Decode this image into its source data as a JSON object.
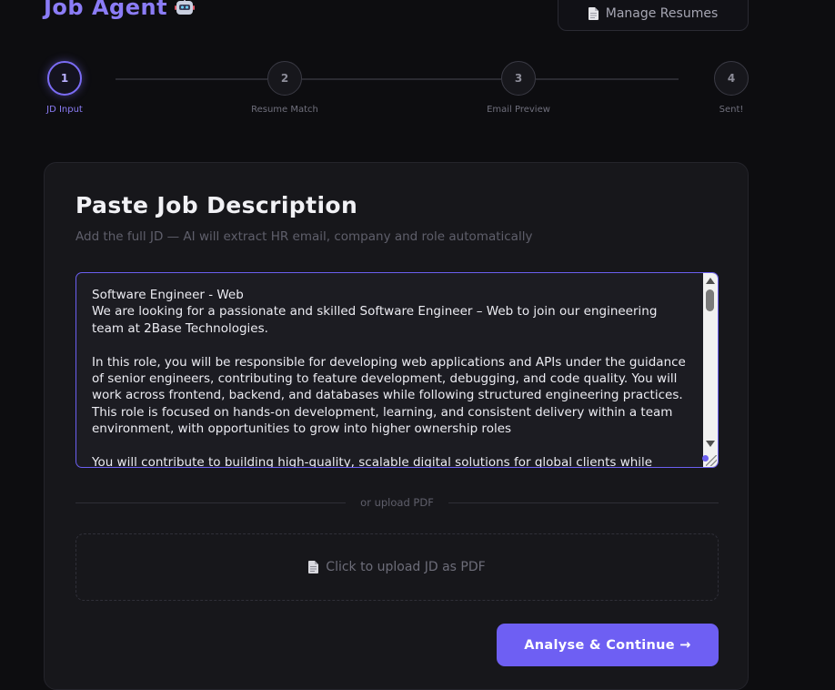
{
  "header": {
    "app_title": "Job Agent",
    "app_icon": "robot-icon",
    "manage_resumes_label": "Manage Resumes",
    "manage_resumes_icon": "document-icon"
  },
  "stepper": {
    "steps": [
      {
        "number": "1",
        "label": "JD Input",
        "active": true
      },
      {
        "number": "2",
        "label": "Resume Match",
        "active": false
      },
      {
        "number": "3",
        "label": "Email Preview",
        "active": false
      },
      {
        "number": "4",
        "label": "Sent!",
        "active": false
      }
    ]
  },
  "card": {
    "title": "Paste Job Description",
    "subtitle": "Add the full JD — AI will extract HR email, company and role automatically",
    "jd_value": "Software Engineer - Web\nWe are looking for a passionate and skilled Software Engineer – Web to join our engineering team at 2Base Technologies.\n\nIn this role, you will be responsible for developing web applications and APIs under the guidance of senior engineers, contributing to feature development, debugging, and code quality. You will work across frontend, backend, and databases while following structured engineering practices. This role is focused on hands-on development, learning, and consistent delivery within a team environment, with opportunities to grow into higher ownership roles\n\nYou will contribute to building high-quality, scalable digital solutions for global clients while",
    "divider_text": "or upload PDF",
    "upload_label": "Click to upload JD as PDF",
    "upload_icon": "document-icon",
    "submit_label": "Analyse & Continue →"
  },
  "colors": {
    "accent": "#6e5ff3",
    "accent_text": "#8b7cf6",
    "background": "#0d0d10",
    "card": "#17171b"
  }
}
